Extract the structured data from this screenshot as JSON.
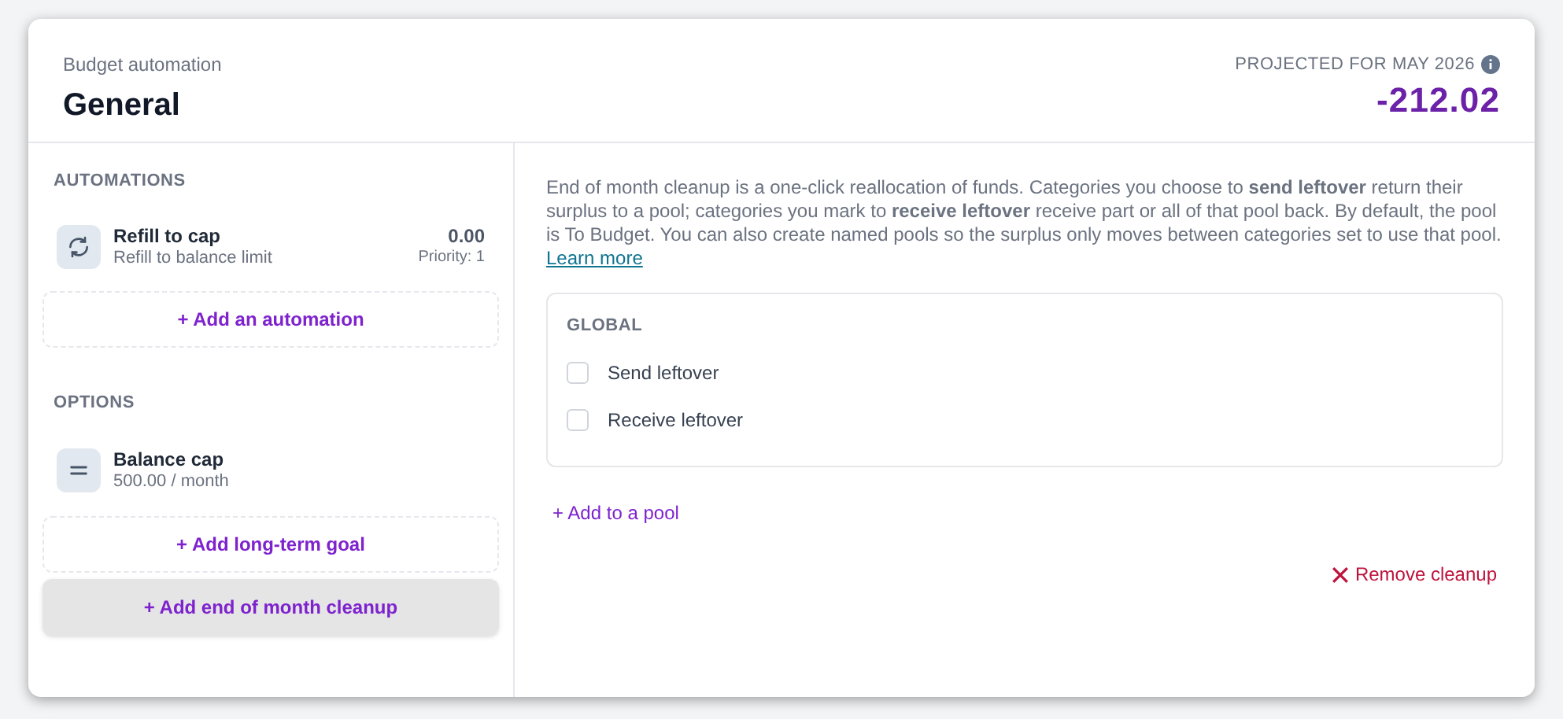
{
  "header": {
    "subtitle": "Budget automation",
    "title": "General",
    "projection_label": "PROJECTED FOR MAY 2026",
    "projection_value": "-212.02"
  },
  "automations": {
    "heading": "AUTOMATIONS",
    "items": [
      {
        "kind": "refresh",
        "name": "Refill to cap",
        "description": "Refill to balance limit",
        "amount": "0.00",
        "priority": "Priority: 1"
      }
    ],
    "add_button": {
      "label": "+ Add an automation",
      "selected": false
    }
  },
  "options": {
    "heading": "OPTIONS",
    "items": [
      {
        "kind": "equals",
        "name": "Balance cap",
        "description": "500.00 / month"
      }
    ],
    "buttons": [
      {
        "label": "+ Add long-term goal",
        "selected": false
      },
      {
        "label": "+ Add end of month cleanup",
        "selected": true
      }
    ]
  },
  "cleanup": {
    "description": "End of month cleanup is a one-click reallocation of funds. Categories you choose to **send leftover** return their surplus to a pool; categories you mark to **receive leftover** receive part or all of that pool back. By default, the pool is To Budget. You can also create named pools so the surplus only moves between categories set to use that pool.",
    "link": "Learn more",
    "group": {
      "heading": "GLOBAL",
      "options": [
        {
          "label": "Send leftover",
          "checked": false
        },
        {
          "label": "Receive leftover",
          "checked": false
        }
      ]
    },
    "add_pool": "+ Add to a pool",
    "remove": "Remove cleanup"
  }
}
